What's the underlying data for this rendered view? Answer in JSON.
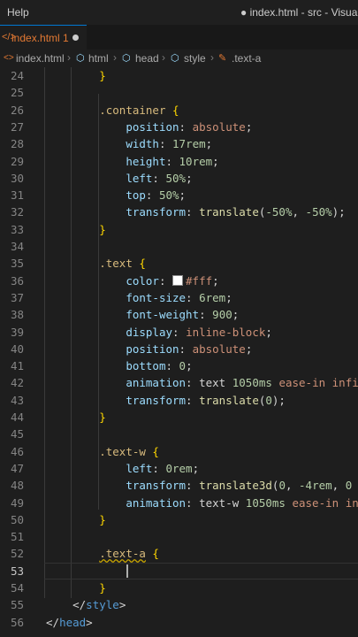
{
  "titlebar": {
    "menu_label": "Help",
    "window_title": "● index.html - src - Visual St"
  },
  "tab": {
    "icon": "</>",
    "label": "index.html 1"
  },
  "breadcrumb": {
    "items": [
      {
        "icon": "html-icon",
        "label": "index.html"
      },
      {
        "icon": "tag-icon",
        "label": "html"
      },
      {
        "icon": "tag-icon",
        "label": "head"
      },
      {
        "icon": "tag-icon",
        "label": "style"
      },
      {
        "icon": "selector-icon",
        "label": ".text-a"
      }
    ]
  },
  "editor": {
    "active_line": 53,
    "lines": [
      {
        "n": "24",
        "tokens": [
          [
            "        ",
            "punc"
          ],
          [
            "}",
            "brace"
          ]
        ]
      },
      {
        "n": "25",
        "tokens": []
      },
      {
        "n": "26",
        "tokens": [
          [
            "        ",
            "punc"
          ],
          [
            ".container",
            "sel"
          ],
          [
            " {",
            "brace"
          ]
        ]
      },
      {
        "n": "27",
        "tokens": [
          [
            "            ",
            "punc"
          ],
          [
            "position",
            "prop"
          ],
          [
            ": ",
            "punc"
          ],
          [
            "absolute",
            "val"
          ],
          [
            ";",
            "punc"
          ]
        ]
      },
      {
        "n": "28",
        "tokens": [
          [
            "            ",
            "punc"
          ],
          [
            "width",
            "prop"
          ],
          [
            ": ",
            "punc"
          ],
          [
            "17rem",
            "num"
          ],
          [
            ";",
            "punc"
          ]
        ]
      },
      {
        "n": "29",
        "tokens": [
          [
            "            ",
            "punc"
          ],
          [
            "height",
            "prop"
          ],
          [
            ": ",
            "punc"
          ],
          [
            "10rem",
            "num"
          ],
          [
            ";",
            "punc"
          ]
        ]
      },
      {
        "n": "30",
        "tokens": [
          [
            "            ",
            "punc"
          ],
          [
            "left",
            "prop"
          ],
          [
            ": ",
            "punc"
          ],
          [
            "50%",
            "num"
          ],
          [
            ";",
            "punc"
          ]
        ]
      },
      {
        "n": "31",
        "tokens": [
          [
            "            ",
            "punc"
          ],
          [
            "top",
            "prop"
          ],
          [
            ": ",
            "punc"
          ],
          [
            "50%",
            "num"
          ],
          [
            ";",
            "punc"
          ]
        ]
      },
      {
        "n": "32",
        "tokens": [
          [
            "            ",
            "punc"
          ],
          [
            "transform",
            "prop"
          ],
          [
            ": ",
            "punc"
          ],
          [
            "translate",
            "fn"
          ],
          [
            "(",
            "punc"
          ],
          [
            "-50%",
            "num"
          ],
          [
            ", ",
            "punc"
          ],
          [
            "-50%",
            "num"
          ],
          [
            ");",
            "punc"
          ]
        ]
      },
      {
        "n": "33",
        "tokens": [
          [
            "        ",
            "punc"
          ],
          [
            "}",
            "brace"
          ]
        ]
      },
      {
        "n": "34",
        "tokens": []
      },
      {
        "n": "35",
        "tokens": [
          [
            "        ",
            "punc"
          ],
          [
            ".text",
            "sel"
          ],
          [
            " {",
            "brace"
          ]
        ]
      },
      {
        "n": "36",
        "tokens": [
          [
            "            ",
            "punc"
          ],
          [
            "color",
            "prop"
          ],
          [
            ": ",
            "punc"
          ],
          [
            "SWATCH",
            "swatch"
          ],
          [
            "#fff",
            "val"
          ],
          [
            ";",
            "punc"
          ]
        ]
      },
      {
        "n": "37",
        "tokens": [
          [
            "            ",
            "punc"
          ],
          [
            "font-size",
            "prop"
          ],
          [
            ": ",
            "punc"
          ],
          [
            "6rem",
            "num"
          ],
          [
            ";",
            "punc"
          ]
        ]
      },
      {
        "n": "38",
        "tokens": [
          [
            "            ",
            "punc"
          ],
          [
            "font-weight",
            "prop"
          ],
          [
            ": ",
            "punc"
          ],
          [
            "900",
            "num"
          ],
          [
            ";",
            "punc"
          ]
        ]
      },
      {
        "n": "39",
        "tokens": [
          [
            "            ",
            "punc"
          ],
          [
            "display",
            "prop"
          ],
          [
            ": ",
            "punc"
          ],
          [
            "inline-block",
            "val"
          ],
          [
            ";",
            "punc"
          ]
        ]
      },
      {
        "n": "40",
        "tokens": [
          [
            "            ",
            "punc"
          ],
          [
            "position",
            "prop"
          ],
          [
            ": ",
            "punc"
          ],
          [
            "absolute",
            "val"
          ],
          [
            ";",
            "punc"
          ]
        ]
      },
      {
        "n": "41",
        "tokens": [
          [
            "            ",
            "punc"
          ],
          [
            "bottom",
            "prop"
          ],
          [
            ": ",
            "punc"
          ],
          [
            "0",
            "num"
          ],
          [
            ";",
            "punc"
          ]
        ]
      },
      {
        "n": "42",
        "tokens": [
          [
            "            ",
            "punc"
          ],
          [
            "animation",
            "prop"
          ],
          [
            ": ",
            "punc"
          ],
          [
            "text ",
            "punc"
          ],
          [
            "1050ms",
            "num"
          ],
          [
            " ",
            "punc"
          ],
          [
            "ease-in",
            "val"
          ],
          [
            " infi",
            "val"
          ]
        ]
      },
      {
        "n": "43",
        "tokens": [
          [
            "            ",
            "punc"
          ],
          [
            "transform",
            "prop"
          ],
          [
            ": ",
            "punc"
          ],
          [
            "translate",
            "fn"
          ],
          [
            "(",
            "punc"
          ],
          [
            "0",
            "num"
          ],
          [
            ");",
            "punc"
          ]
        ]
      },
      {
        "n": "44",
        "tokens": [
          [
            "        ",
            "punc"
          ],
          [
            "}",
            "brace"
          ]
        ]
      },
      {
        "n": "45",
        "tokens": []
      },
      {
        "n": "46",
        "tokens": [
          [
            "        ",
            "punc"
          ],
          [
            ".text-w",
            "sel"
          ],
          [
            " {",
            "brace"
          ]
        ]
      },
      {
        "n": "47",
        "tokens": [
          [
            "            ",
            "punc"
          ],
          [
            "left",
            "prop"
          ],
          [
            ": ",
            "punc"
          ],
          [
            "0rem",
            "num"
          ],
          [
            ";",
            "punc"
          ]
        ]
      },
      {
        "n": "48",
        "tokens": [
          [
            "            ",
            "punc"
          ],
          [
            "transform",
            "prop"
          ],
          [
            ": ",
            "punc"
          ],
          [
            "translate3d",
            "fn"
          ],
          [
            "(",
            "punc"
          ],
          [
            "0",
            "num"
          ],
          [
            ", ",
            "punc"
          ],
          [
            "-4rem",
            "num"
          ],
          [
            ", ",
            "punc"
          ],
          [
            "0",
            "num"
          ]
        ]
      },
      {
        "n": "49",
        "tokens": [
          [
            "            ",
            "punc"
          ],
          [
            "animation",
            "prop"
          ],
          [
            ": ",
            "punc"
          ],
          [
            "text-w ",
            "punc"
          ],
          [
            "1050ms",
            "num"
          ],
          [
            " ",
            "punc"
          ],
          [
            "ease-in",
            "val"
          ],
          [
            " in",
            "val"
          ]
        ]
      },
      {
        "n": "50",
        "tokens": [
          [
            "        ",
            "punc"
          ],
          [
            "}",
            "brace"
          ]
        ]
      },
      {
        "n": "51",
        "tokens": []
      },
      {
        "n": "52",
        "tokens": [
          [
            "        ",
            "punc"
          ],
          [
            ".text-a",
            "sel squig"
          ],
          [
            " {",
            "brace"
          ]
        ]
      },
      {
        "n": "53",
        "tokens": []
      },
      {
        "n": "54",
        "tokens": [
          [
            "        ",
            "punc"
          ],
          [
            "}",
            "brace"
          ]
        ]
      },
      {
        "n": "55",
        "tokens": [
          [
            "    ",
            "punc"
          ],
          [
            "</",
            "punc"
          ],
          [
            "style",
            "tag"
          ],
          [
            ">",
            "punc"
          ]
        ]
      },
      {
        "n": "56",
        "tokens": [
          [
            "</",
            "punc"
          ],
          [
            "head",
            "tag"
          ],
          [
            ">",
            "punc"
          ]
        ]
      }
    ]
  }
}
